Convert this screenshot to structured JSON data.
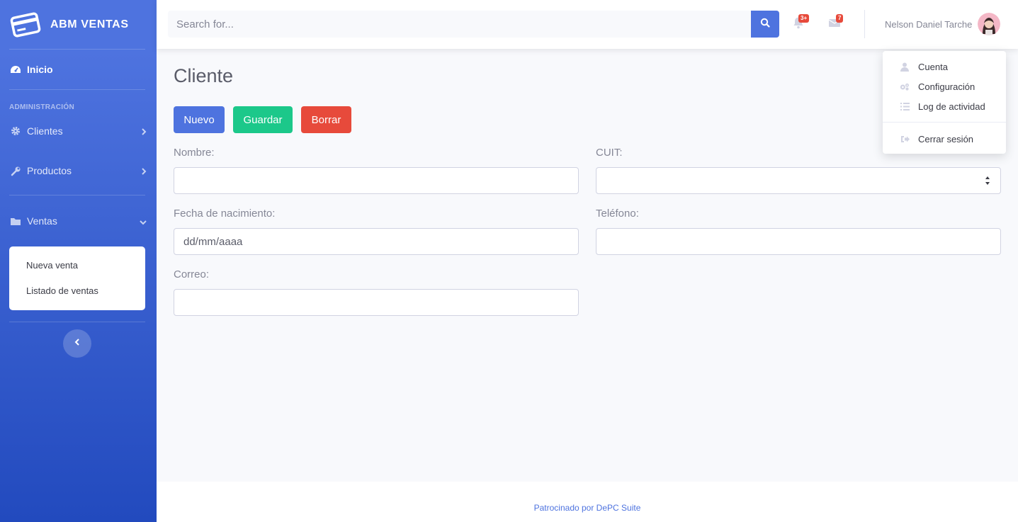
{
  "brand": {
    "title": "ABM VENTAS",
    "icon": "credit-card-icon"
  },
  "sidebar": {
    "home": {
      "label": "Inicio",
      "icon": "tachometer-icon"
    },
    "heading": "ADMINISTRACIÓN",
    "items": [
      {
        "label": "Clientes",
        "icon": "cog-icon"
      },
      {
        "label": "Productos",
        "icon": "wrench-icon"
      },
      {
        "label": "Ventas",
        "icon": "folder-icon"
      }
    ],
    "submenu": [
      "Nueva venta",
      "Listado de ventas"
    ]
  },
  "topbar": {
    "search_placeholder": "Search for...",
    "alerts_count": "3+",
    "messages_count": "7",
    "user_name": "Nelson Daniel Tarche"
  },
  "dropdown": {
    "items": [
      {
        "label": "Cuenta",
        "icon": "user-icon"
      },
      {
        "label": "Configuración",
        "icon": "cogs-icon"
      },
      {
        "label": "Log de actividad",
        "icon": "list-icon"
      }
    ],
    "logout": {
      "label": "Cerrar sesión",
      "icon": "sign-out-icon"
    }
  },
  "main": {
    "title": "Cliente",
    "buttons": {
      "new": "Nuevo",
      "save": "Guardar",
      "delete": "Borrar"
    },
    "fields": {
      "nombre": {
        "label": "Nombre:",
        "value": ""
      },
      "cuit": {
        "label": "CUIT:",
        "value": ""
      },
      "fecha": {
        "label": "Fecha de nacimiento:",
        "value": "dd/mm/aaaa"
      },
      "telefono": {
        "label": "Teléfono:",
        "value": ""
      },
      "correo": {
        "label": "Correo:",
        "value": ""
      }
    }
  },
  "footer": {
    "text": "Patrocinado por DePC Suite"
  },
  "colors": {
    "primary": "#4e73df",
    "success": "#1cc88a",
    "danger": "#e74a3b"
  }
}
